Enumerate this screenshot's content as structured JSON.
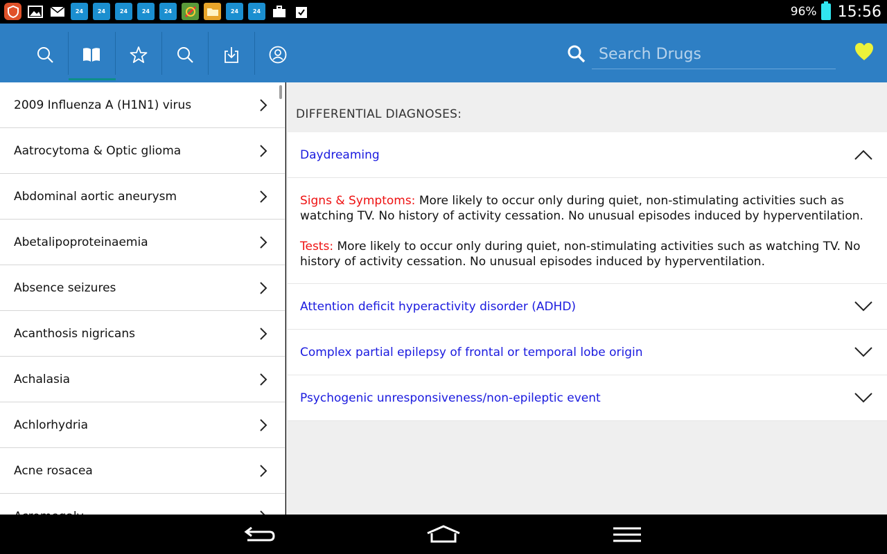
{
  "statusbar": {
    "battery_pct": "96%",
    "time": "15:56",
    "notification_icons": [
      "shield-icon",
      "image-icon",
      "mail-icon",
      "france24-icon",
      "france24-icon",
      "france24-icon",
      "france24-icon",
      "france24-icon",
      "app-icon",
      "folder-icon",
      "france24-icon",
      "france24-icon",
      "briefcase-icon",
      "clipboard-check-icon"
    ]
  },
  "toolbar": {
    "buttons": [
      "search-icon",
      "book-icon",
      "star-icon",
      "search-icon",
      "download-icon",
      "profile-icon"
    ],
    "search_placeholder": "Search Drugs",
    "accent": "#2e7fc4"
  },
  "list": {
    "items": [
      "2009 Influenza A (H1N1) virus",
      "Aatrocytoma & Optic glioma",
      "Abdominal aortic aneurysm",
      "Abetalipoproteinaemia",
      "Absence seizures",
      "Acanthosis nigricans",
      "Achalasia",
      "Achlorhydria",
      "Acne rosacea",
      "Acromegaly"
    ]
  },
  "detail": {
    "section_title": "DIFFERENTIAL DIAGNOSES:",
    "expanded": {
      "title": "Daydreaming",
      "signs_label": "Signs & Symptoms:",
      "signs_text": " More likely to occur only during quiet, non-stimulating activities such as watching TV. No history of activity cessation. No unusual episodes induced by hyperventilation.",
      "tests_label": "Tests:",
      "tests_text": " More likely to occur only during quiet, non-stimulating activities such as watching TV. No history of activity cessation. No unusual episodes induced by hyperventilation."
    },
    "collapsed": [
      "Attention deficit hyperactivity disorder (ADHD)",
      "Complex partial epilepsy of frontal or temporal lobe origin",
      "Psychogenic unresponsiveness/non-epileptic event"
    ]
  },
  "navbar": {
    "buttons": [
      "back-icon",
      "home-icon",
      "menu-icon"
    ]
  }
}
